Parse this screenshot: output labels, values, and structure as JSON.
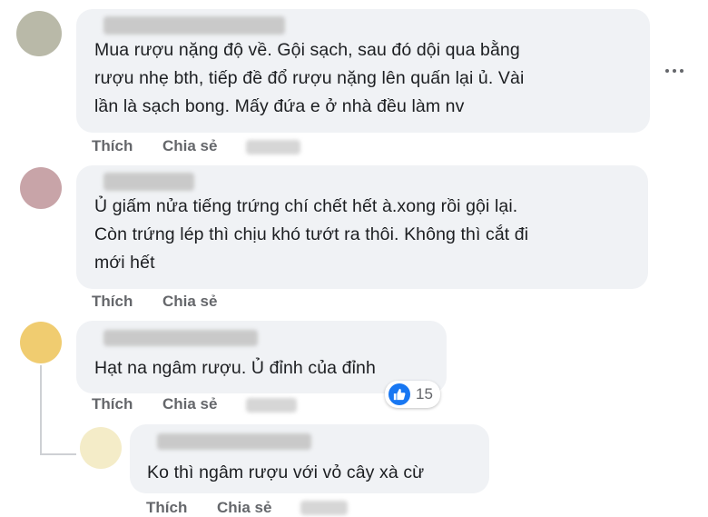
{
  "colors": {
    "bubble": "#f0f2f5",
    "action_text": "#65676b",
    "like_blue": "#1877f2"
  },
  "comments": [
    {
      "text": "Mua rượu nặng độ về. Gội sạch, sau đó dội qua bằng\nrượu nhẹ bth, tiếp đề đổ rượu nặng lên quấn lại ủ. Vài\nlần là sạch bong. Mấy đứa e ở nhà đều làm nv",
      "like_label": "Thích",
      "share_label": "Chia sẻ"
    },
    {
      "text": "Ủ giấm nửa tiếng trứng chí chết hết à.xong rồi gội lại.\nCòn trứng lép thì chịu khó tướt ra thôi. Không thì cắt đi\nmới hết",
      "like_label": "Thích",
      "share_label": "Chia sẻ"
    },
    {
      "text": "Hạt na ngâm rượu. Ủ đỉnh của đỉnh",
      "like_label": "Thích",
      "share_label": "Chia sẻ",
      "reaction_icon": "like-icon",
      "reaction_count": "15"
    },
    {
      "text": "Ko thì ngâm rượu với vỏ cây xà cừ",
      "like_label": "Thích",
      "share_label": "Chia sẻ"
    }
  ],
  "more_icon": "more-horizontal-icon"
}
